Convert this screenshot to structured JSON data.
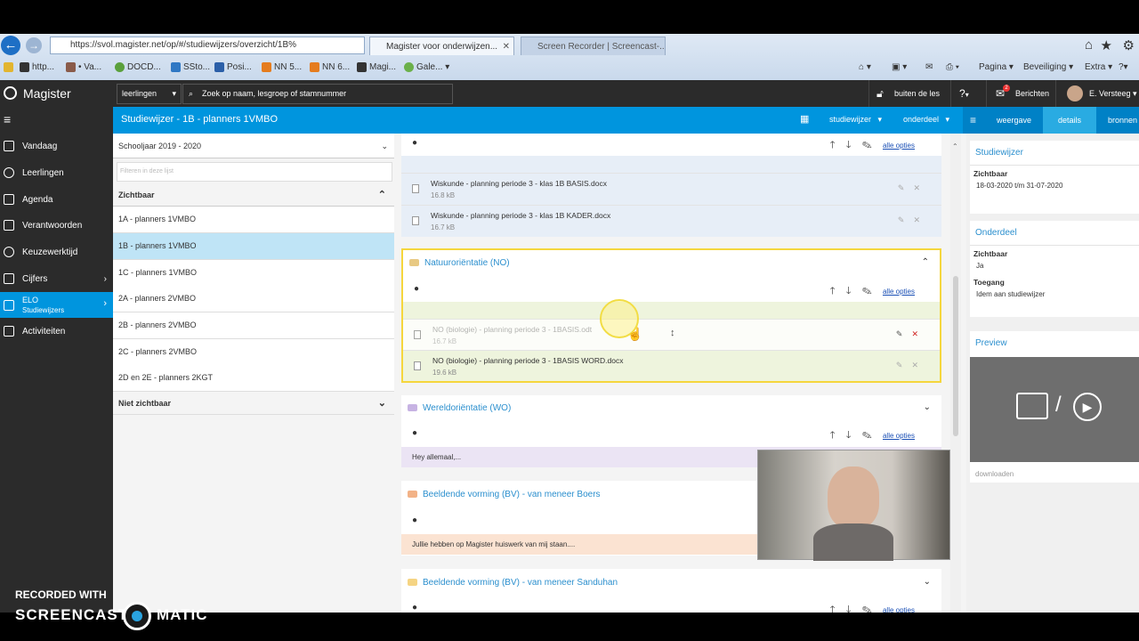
{
  "browser": {
    "url": "https://svol.magister.net/op/#/studiewijzers/overzicht/1B%",
    "tabs": [
      {
        "label": "Magister voor onderwijzen...",
        "active": true
      },
      {
        "label": "Screen Recorder | Screencast-...",
        "active": false
      }
    ],
    "favorites": [
      "http...",
      "Va...",
      "DOCD...",
      "SSto...",
      "Posi...",
      "NN 5...",
      "NN 6...",
      "Magi...",
      "Gale..."
    ],
    "commands": [
      "Pagina",
      "Beveiliging",
      "Extra"
    ]
  },
  "app": {
    "logo": "Magister",
    "search_scope": "leerlingen",
    "search_placeholder": "Zoek op naam, lesgroep of stamnummer",
    "buiten_de_les": "buiten de les",
    "berichten": "Berichten",
    "berichten_count": "2",
    "user": "E. Versteeg"
  },
  "subbar": {
    "title": "Studiewijzer - 1B - planners 1VMBO",
    "studiewijzer_label": "studiewijzer",
    "onderdeel_label": "onderdeel",
    "tabs": [
      "weergave",
      "details",
      "bronnen"
    ]
  },
  "sidebar": {
    "items": [
      {
        "label": "Vandaag",
        "icon": "home-icon"
      },
      {
        "label": "Leerlingen",
        "icon": "students-icon"
      },
      {
        "label": "Agenda",
        "icon": "calendar-icon"
      },
      {
        "label": "Verantwoorden",
        "icon": "checklist-icon"
      },
      {
        "label": "Keuzewerktijd",
        "icon": "choice-icon"
      },
      {
        "label": "Cijfers",
        "icon": "grid-icon"
      },
      {
        "label": "ELO",
        "sub": "Studiewijzers",
        "icon": "elo-icon",
        "active": true
      },
      {
        "label": "Activiteiten",
        "icon": "activity-icon"
      }
    ]
  },
  "leftpanel": {
    "schoolyear": "Schooljaar 2019 - 2020",
    "filter_placeholder": "Filteren in deze lijst",
    "zichtbaar_header": "Zichtbaar",
    "items": [
      "1A - planners 1VMBO",
      "1B - planners 1VMBO",
      "1C - planners 1VMBO",
      "2A - planners 2VMBO",
      "2B - planners 2VMBO",
      "2C - planners 2VMBO",
      "2D en 2E - planners 2KGT"
    ],
    "niet_zichtbaar_header": "Niet zichtbaar"
  },
  "center": {
    "alle_opties": "alle opties",
    "top_files": [
      {
        "name": "Wiskunde - planning periode 3 - klas 1B BASIS.docx",
        "size": "16.8 kB"
      },
      {
        "name": "Wiskunde - planning periode 3 - klas 1B KADER.docx",
        "size": "16.7 kB"
      }
    ],
    "no_section": {
      "title": "Natuuroriëntatie (NO)",
      "files": [
        {
          "name": "NO (biologie) - planning periode 3 - 1BASIS.odt",
          "size": "16.7 kB"
        },
        {
          "name": "NO (biologie) - planning periode 3 - 1BASIS WORD.docx",
          "size": "19.6 kB"
        }
      ]
    },
    "wo_section": {
      "title": "Wereldoriëntatie (WO)",
      "text": "Hey allemaal,..."
    },
    "bv_boers": {
      "title": "Beeldende vorming (BV) - van meneer Boers",
      "text": "Jullie hebben op Magister huiswerk van mij staan...."
    },
    "bv_sanduhan": {
      "title": "Beeldende vorming (BV) - van meneer Sanduhan"
    }
  },
  "rightpanel": {
    "studiewijzer_header": "Studiewijzer",
    "zichtbaar_label": "Zichtbaar",
    "zichtbaar_range": "18-03-2020 t/m 31-07-2020",
    "onderdeel_header": "Onderdeel",
    "onderdeel_zichtbaar_label": "Zichtbaar",
    "onderdeel_zichtbaar_value": "Ja",
    "toegang_label": "Toegang",
    "toegang_value": "Idem aan studiewijzer",
    "preview_header": "Preview",
    "downloaden": "downloaden"
  },
  "watermark": {
    "line1": "RECORDED WITH",
    "line2": "SCREENCAST",
    "line3": "MATIC"
  }
}
